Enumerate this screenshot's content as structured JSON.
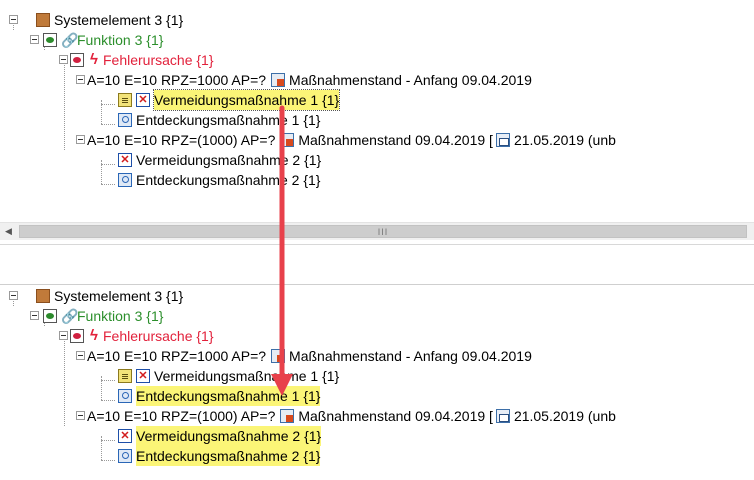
{
  "top_tree": {
    "system": "Systemelement 3 {1}",
    "function": "Funktion 3 {1}",
    "cause": "Fehlerursache {1}",
    "rating1": "A=10 E=10 RPZ=1000 AP=?",
    "stand1": "Maßnahmenstand - Anfang 09.04.2019",
    "prevention1": "Vermeidungsmaßnahme 1 {1}",
    "detection1": "Entdeckungsmaßnahme 1 {1}",
    "rating2": "A=10 E=10 RPZ=(1000) AP=?",
    "stand2": "Maßnahmenstand 09.04.2019 [",
    "date2": "21.05.2019 (unb",
    "prevention2": "Vermeidungsmaßnahme 2 {1}",
    "detection2": "Entdeckungsmaßnahme 2 {1}",
    "scroll_grip": "III"
  },
  "bottom_tree": {
    "system": "Systemelement 3 {1}",
    "function": "Funktion 3 {1}",
    "cause": "Fehlerursache {1}",
    "rating1": "A=10 E=10 RPZ=1000 AP=?",
    "stand1": "Maßnahmenstand - Anfang 09.04.2019",
    "prevention1": "Vermeidungsmaßnahme 1 {1}",
    "detection1": "Entdeckungsmaßnahme 1 {1}",
    "rating2": "A=10 E=10 RPZ=(1000) AP=?",
    "stand2": "Maßnahmenstand 09.04.2019 [",
    "date2": "21.05.2019 (unb",
    "prevention2": "Vermeidungsmaßnahme 2 {1}",
    "detection2": "Entdeckungsmaßnahme 2 {1}"
  },
  "colors": {
    "highlight": "#fbf577",
    "arrow": "#e8414b",
    "function_text": "#2c8f2c",
    "cause_text": "#e2213b"
  }
}
